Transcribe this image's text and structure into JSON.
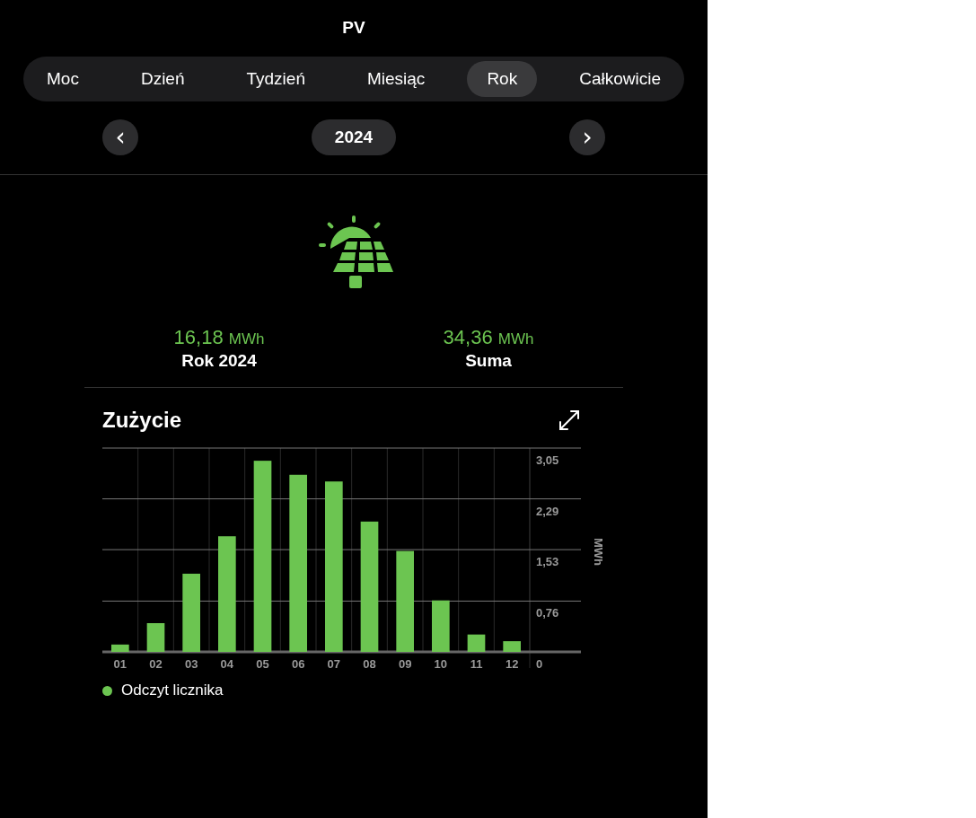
{
  "header": {
    "title": "PV"
  },
  "tabs": [
    {
      "label": "Moc",
      "selected": false
    },
    {
      "label": "Dzień",
      "selected": false
    },
    {
      "label": "Tydzień",
      "selected": false
    },
    {
      "label": "Miesiąc",
      "selected": false
    },
    {
      "label": "Rok",
      "selected": true
    },
    {
      "label": "Całkowicie",
      "selected": false
    }
  ],
  "period": {
    "prev": "‹",
    "value": "2024",
    "next": "›"
  },
  "stats": [
    {
      "value": "16,18",
      "unit": "MWh",
      "label": "Rok 2024"
    },
    {
      "value": "34,36",
      "unit": "MWh",
      "label": "Suma"
    }
  ],
  "chart": {
    "title": "Zużycie",
    "chart_data": {
      "type": "bar",
      "grid": true,
      "ylabel": "MWh",
      "categories": [
        "01",
        "02",
        "03",
        "04",
        "05",
        "06",
        "07",
        "08",
        "09",
        "10",
        "11",
        "12"
      ],
      "series": [
        {
          "name": "Odczyt licznika",
          "color": "#6cc551",
          "values": [
            0.11,
            0.43,
            1.17,
            1.73,
            2.86,
            2.65,
            2.55,
            1.95,
            1.51,
            0.77,
            0.26,
            0.16
          ]
        }
      ],
      "ylim": [
        0,
        3.05
      ],
      "yticks": [
        {
          "value": 0,
          "label": "0"
        },
        {
          "value": 0.76,
          "label": "0,76"
        },
        {
          "value": 1.53,
          "label": "1,53"
        },
        {
          "value": 2.29,
          "label": "2,29"
        },
        {
          "value": 3.05,
          "label": "3,05"
        }
      ]
    }
  }
}
